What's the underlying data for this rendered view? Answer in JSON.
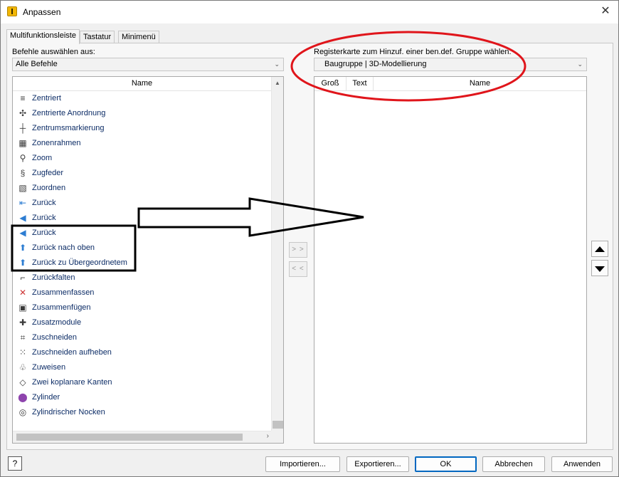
{
  "window": {
    "title": "Anpassen",
    "close_glyph": "✕"
  },
  "tabs": [
    {
      "label": "Multifunktionsleiste",
      "active": true
    },
    {
      "label": "Tastatur",
      "active": false
    },
    {
      "label": "Minimenü",
      "active": false
    }
  ],
  "left": {
    "label": "Befehle auswählen aus:",
    "combo_value": "Alle Befehle",
    "column_name": "Name",
    "commands": [
      {
        "label": "Zentriert",
        "icon": "≡"
      },
      {
        "label": "Zentrierte Anordnung",
        "icon": "✣"
      },
      {
        "label": "Zentrumsmarkierung",
        "icon": "┼"
      },
      {
        "label": "Zonenrahmen",
        "icon": "▦"
      },
      {
        "label": "Zoom",
        "icon": "⚲"
      },
      {
        "label": "Zugfeder",
        "icon": "§"
      },
      {
        "label": "Zuordnen",
        "icon": "▧"
      },
      {
        "label": "Zurück",
        "icon": "⇤"
      },
      {
        "label": "Zurück",
        "icon": "◀"
      },
      {
        "label": "Zurück",
        "icon": "◀"
      },
      {
        "label": "Zurück nach oben",
        "icon": "⬆"
      },
      {
        "label": "Zurück zu Übergeordnetem",
        "icon": "⬆"
      },
      {
        "label": "Zurückfalten",
        "icon": "⌐"
      },
      {
        "label": "Zusammenfassen",
        "icon": "✕"
      },
      {
        "label": "Zusammenfügen",
        "icon": "▣"
      },
      {
        "label": "Zusatzmodule",
        "icon": "✚"
      },
      {
        "label": "Zuschneiden",
        "icon": "⌗"
      },
      {
        "label": "Zuschneiden aufheben",
        "icon": "⁙"
      },
      {
        "label": "Zuweisen",
        "icon": "♧"
      },
      {
        "label": "Zwei koplanare Kanten",
        "icon": "◇"
      },
      {
        "label": "Zylinder",
        "icon": "⬤"
      },
      {
        "label": "Zylindrischer Nocken",
        "icon": "◎"
      }
    ]
  },
  "right": {
    "label": "Registerkarte zum Hinzuf. einer ben.def. Gruppe wählen:",
    "combo_value": "Baugruppe | 3D-Modellierung",
    "columns": [
      "Groß",
      "Text",
      "Name"
    ]
  },
  "transfer": {
    "add_label": "> >",
    "remove_label": "< <"
  },
  "buttons": {
    "help": "?",
    "import": "Importieren...",
    "export": "Exportieren...",
    "ok": "OK",
    "cancel": "Abbrechen",
    "apply": "Anwenden"
  },
  "annotation_colors": {
    "ellipse": "#e0151b",
    "arrow": "#000000",
    "box": "#000000"
  }
}
